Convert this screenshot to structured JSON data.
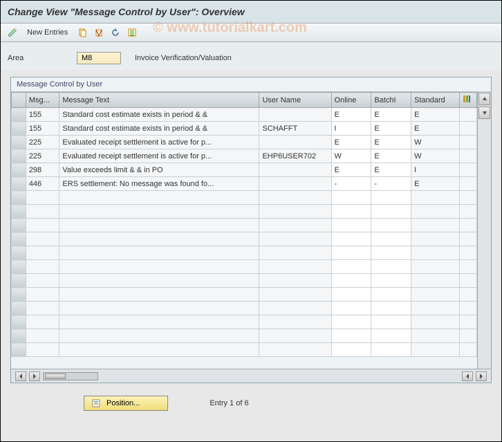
{
  "title": "Change View \"Message Control by User\": Overview",
  "toolbar": {
    "new_entries": "New Entries"
  },
  "area": {
    "label": "Area",
    "value": "M8",
    "description": "Invoice Verification/Valuation"
  },
  "panel": {
    "title": "Message Control by User"
  },
  "columns": {
    "msg": "Msg...",
    "text": "Message Text",
    "user": "User Name",
    "online": "Online",
    "batch": "BatchI",
    "standard": "Standard"
  },
  "rows": [
    {
      "msg": "155",
      "text": "Standard cost estimate exists in period & &",
      "user": "",
      "online": "E",
      "batch": "E",
      "standard": "E"
    },
    {
      "msg": "155",
      "text": "Standard cost estimate exists in period & &",
      "user": "SCHAFFT",
      "online": "I",
      "batch": "E",
      "standard": "E"
    },
    {
      "msg": "225",
      "text": "Evaluated receipt settlement is active for p...",
      "user": "",
      "online": "E",
      "batch": "E",
      "standard": "W"
    },
    {
      "msg": "225",
      "text": "Evaluated receipt settlement is active for p...",
      "user": "EHP6USER702",
      "online": "W",
      "batch": "E",
      "standard": "W"
    },
    {
      "msg": "298",
      "text": "Value exceeds limit & & in PO",
      "user": "",
      "online": "E",
      "batch": "E",
      "standard": "I"
    },
    {
      "msg": "446",
      "text": "ERS settlement: No message was found fo...",
      "user": "",
      "online": "-",
      "batch": "-",
      "standard": "E"
    }
  ],
  "footer": {
    "position": "Position...",
    "entry": "Entry 1 of 6"
  },
  "watermark": "© www.tutorialkart.com"
}
